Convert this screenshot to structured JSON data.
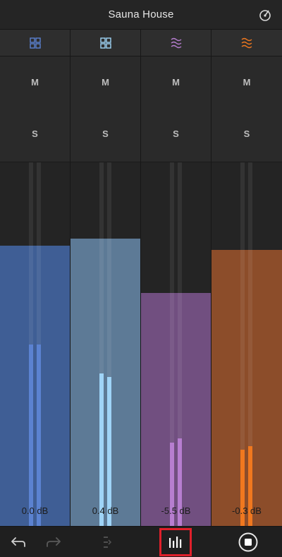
{
  "header": {
    "title": "Sauna House"
  },
  "channels": [
    {
      "id": "ch1",
      "icon": "grid-icon",
      "mute_label": "M",
      "solo_label": "S",
      "db_label": "0.0 dB",
      "color": "#3f5e95",
      "meter_color": "#5b82d1",
      "fader_level": 0.77,
      "meter_l": 0.5,
      "meter_r": 0.5
    },
    {
      "id": "ch2",
      "icon": "grid-icon",
      "mute_label": "M",
      "solo_label": "S",
      "db_label": "0.4 dB",
      "color": "#5d7a96",
      "meter_color": "#9fd4f7",
      "fader_level": 0.79,
      "meter_l": 0.42,
      "meter_r": 0.41
    },
    {
      "id": "ch3",
      "icon": "wave-icon",
      "mute_label": "M",
      "solo_label": "S",
      "db_label": "-5.5 dB",
      "color": "#714f80",
      "meter_color": "#b77ed0",
      "fader_level": 0.64,
      "meter_l": 0.23,
      "meter_r": 0.24
    },
    {
      "id": "ch4",
      "icon": "wave-icon",
      "mute_label": "M",
      "solo_label": "S",
      "db_label": "-0.3 dB",
      "color": "#8c4d2a",
      "meter_color": "#f0781f",
      "fader_level": 0.76,
      "meter_l": 0.21,
      "meter_r": 0.22
    }
  ],
  "icon_colors": {
    "ch1": "#5b82d1",
    "ch2": "#9fd4f7",
    "ch3": "#b77ed0",
    "ch4": "#f0781f"
  },
  "toolbar": {
    "undo_icon": "undo-icon",
    "redo_icon": "redo-icon",
    "route_icon": "route-icon",
    "mixer_icon": "mixer-icon",
    "stop_icon": "stop-icon",
    "highlight_color": "#e0202b"
  }
}
